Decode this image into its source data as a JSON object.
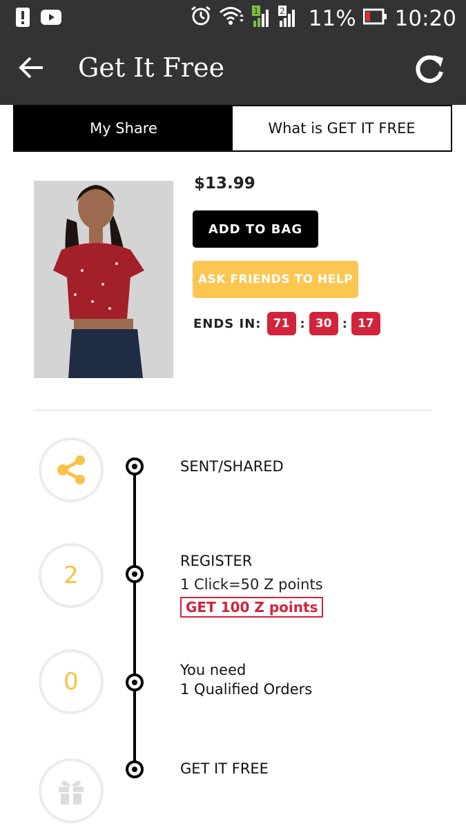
{
  "status_bar": {
    "battery_percent": "11%",
    "time": "10:20",
    "sim1_label": "1",
    "sim2_label": "2",
    "icons": [
      "alert-icon",
      "youtube-icon",
      "alarm-icon",
      "wifi-icon",
      "signal-icon",
      "battery-icon"
    ]
  },
  "app_bar": {
    "title": "Get It Free",
    "icons": [
      "back-arrow-icon",
      "refresh-icon"
    ]
  },
  "tabs": [
    {
      "label": "My Share",
      "active": true
    },
    {
      "label": "What is GET IT FREE",
      "active": false
    }
  ],
  "product": {
    "price": "$13.99",
    "add_to_bag_label": "ADD TO BAG",
    "ask_friends_label": "ASK FRIENDS TO HELP",
    "ends_in_label": "ENDS IN:",
    "timer": {
      "hours": "71",
      "minutes": "30",
      "seconds": "17"
    }
  },
  "steps": {
    "shared": {
      "title": "SENT/SHARED",
      "icon": "share-icon"
    },
    "register": {
      "count": "2",
      "title": "REGISTER",
      "rate": "1 Click=50 Z points",
      "points_label": "GET 100 Z points"
    },
    "orders": {
      "count": "0",
      "line1": "You need",
      "line2": "1 Qualified Orders"
    },
    "free": {
      "title": "GET IT FREE",
      "icon": "gift-icon"
    }
  },
  "colors": {
    "bar_bg": "#333333",
    "accent_yellow": "#fcc651",
    "accent_red": "#d2233b"
  }
}
